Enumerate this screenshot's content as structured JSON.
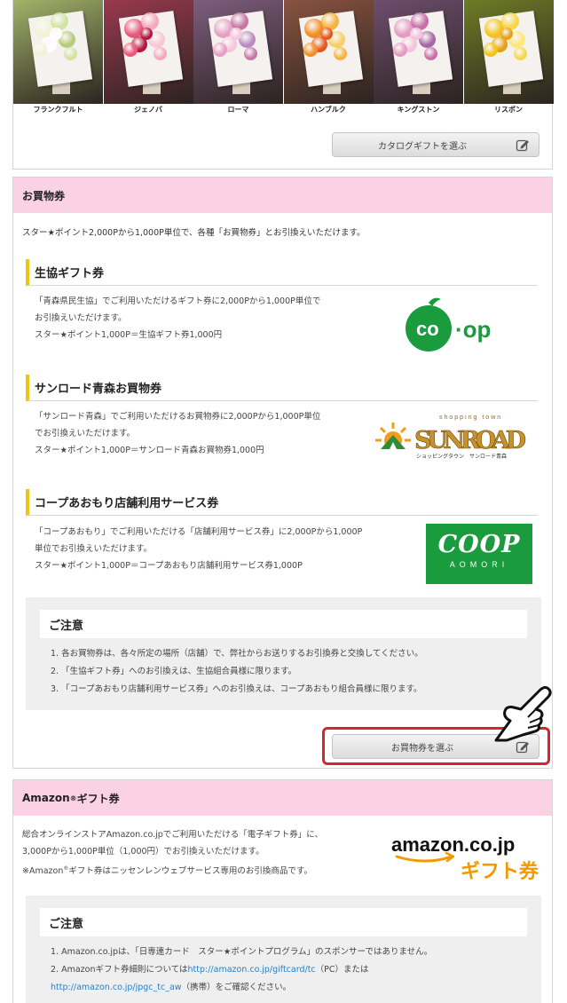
{
  "catalog": {
    "flowers": [
      {
        "name": "フランクフルト",
        "bg": "#a3b56a",
        "colors": [
          "#f1f2d6",
          "#d3e3a3",
          "#ffffff",
          "#b6cc7a"
        ]
      },
      {
        "name": "ジェノバ",
        "bg": "#9a3a4e",
        "colors": [
          "#e9577c",
          "#f5a7bf",
          "#b5163d",
          "#f7c8d6"
        ]
      },
      {
        "name": "ローマ",
        "bg": "#7f5e7f",
        "colors": [
          "#e7a0c5",
          "#c777a7",
          "#f6c6dd",
          "#b98cc0"
        ]
      },
      {
        "name": "ハンブルク",
        "bg": "#8a5440",
        "colors": [
          "#f28d22",
          "#f6b33c",
          "#e4571c",
          "#f7cf6a"
        ]
      },
      {
        "name": "キングストン",
        "bg": "#6e4e6e",
        "colors": [
          "#e49ac2",
          "#c86ea6",
          "#f4c3dc",
          "#a767a5"
        ]
      },
      {
        "name": "リスボン",
        "bg": "#6e7d26",
        "colors": [
          "#f3c41b",
          "#f5d84a",
          "#e7a016",
          "#fbe77a"
        ]
      }
    ],
    "button_label": "カタログギフトを選ぶ"
  },
  "shopping": {
    "heading": "お買物券",
    "intro": "スター★ポイント2,000Pから1,000P単位で、各種「お買物券」とお引換えいただけます。",
    "items": [
      {
        "title": "生協ギフト券",
        "lines": [
          "「青森県民生協」でご利用いただけるギフト券に2,000Pから1,000P単位で",
          "お引換えいただけます。",
          "スター★ポイント1,000P＝生協ギフト券1,000円"
        ],
        "logo": "CO·OP"
      },
      {
        "title": "サンロード青森お買物券",
        "lines": [
          "「サンロード青森」でご利用いただけるお買物券に2,000Pから1,000P単位",
          "でお引換えいただけます。",
          "スター★ポイント1,000P＝サンロード青森お買物券1,000円"
        ],
        "logo_top": "shopping town",
        "logo_main": "SUNROAD",
        "logo_sub": "ショッピングタウン　サンロード青森"
      },
      {
        "title": "コープあおもり店舗利用サービス券",
        "lines": [
          "「コープあおもり」でご利用いただける「店舗利用サービス券」に2,000Pから1,000P",
          "単位でお引換えいただけます。",
          "スター★ポイント1,000P＝コープあおもり店舗利用サービス券1,000P"
        ],
        "logo_main": "COOP",
        "logo_sub": "AOMORI"
      }
    ],
    "notice_title": "ご注意",
    "notices": [
      "1. 各お買物券は、各々所定の場所（店舗）で、弊社からお送りするお引換券と交換してください。",
      "2. 「生協ギフト券」へのお引換えは、生協組合員様に限ります。",
      "3. 「コープあおもり店舗利用サービス券」へのお引換えは、コープあおもり組合員様に限ります。"
    ],
    "button_label": "お買物券を選ぶ"
  },
  "amazon": {
    "heading_main": "Amazon",
    "heading_reg": "®",
    "heading_rest": "ギフト券",
    "lines": [
      "総合オンラインストアAmazon.co.jpでご利用いただける「電子ギフト券」に、",
      "3,000Pから1,000P単位（1,000円）でお引換えいただけます。"
    ],
    "line3_a": "※Amazon",
    "line3_reg": "®",
    "line3_b": "ギフト券はニッセンレンウェブサービス専用のお引換商品です。",
    "logo_main": "amazon.co.jp",
    "logo_sub": "ギフト券",
    "notice_title": "ご注意",
    "notice1": "1. Amazon.co.jpは、「日専連カード　スター★ポイントプログラム」のスポンサーではありません。",
    "notice2_a": "2. Amazonギフト券細則については",
    "notice2_link1": "http://amazon.co.jp/giftcard/tc",
    "notice2_b": "（PC）または",
    "notice2_link2": "http://amazon.co.jp/jpgc_tc_aw",
    "notice2_c": "（携帯）をご確認ください。"
  },
  "colors": {
    "header_pink": "#fbd2e4",
    "accent_yellow": "#f1c40f",
    "highlight_red": "#d9232d",
    "coop_green": "#1a9b3d",
    "amazon_orange": "#f39800",
    "link_blue": "#2a7fc1"
  }
}
